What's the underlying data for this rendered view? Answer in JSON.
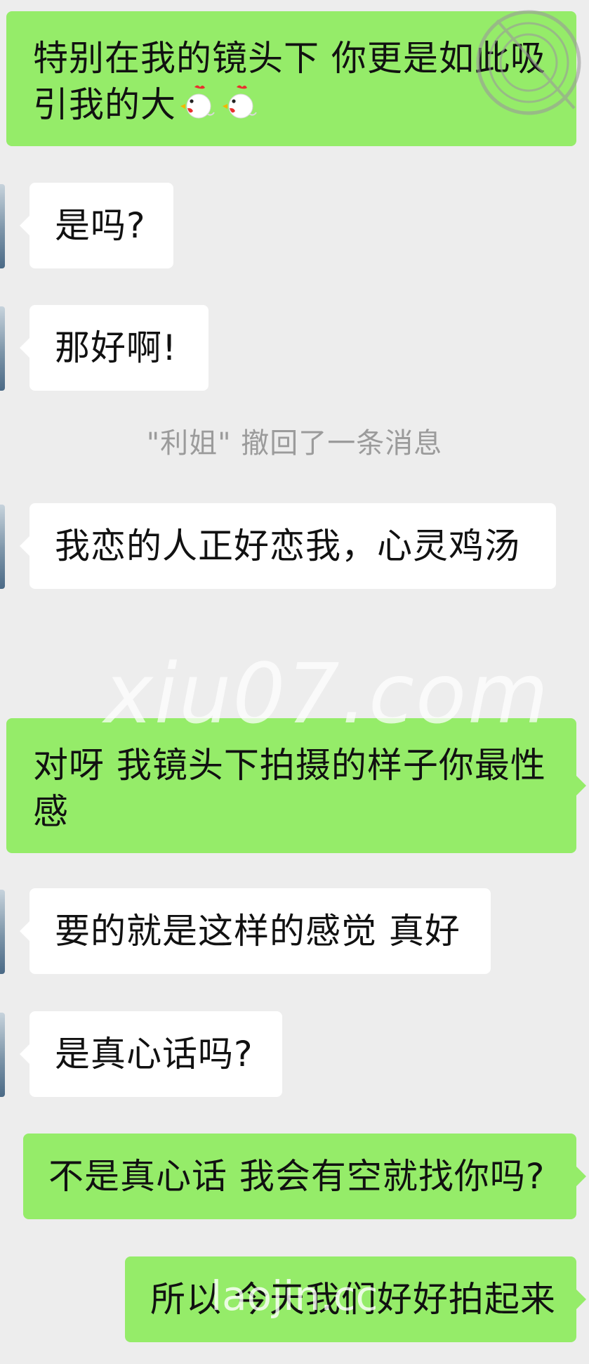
{
  "messages": [
    {
      "id": "m1",
      "side": "sent",
      "text": "特别在我的镜头下 你更是如此吸引我的大",
      "emoji": "rooster-emoji"
    },
    {
      "id": "m2",
      "side": "received",
      "text": "是吗?"
    },
    {
      "id": "m3",
      "side": "received",
      "text": "那好啊!"
    },
    {
      "id": "sys1",
      "side": "system",
      "text": "\"利姐\" 撤回了一条消息"
    },
    {
      "id": "m4",
      "side": "received",
      "text": "我恋的人正好恋我，心灵鸡汤"
    },
    {
      "id": "m5",
      "side": "sent",
      "text": "对呀 我镜头下拍摄的样子你最性感"
    },
    {
      "id": "m6",
      "side": "received",
      "text": "要的就是这样的感觉 真好"
    },
    {
      "id": "m7",
      "side": "received",
      "text": "是真心话吗?"
    },
    {
      "id": "m8",
      "side": "sent",
      "text": "不是真心话 我会有空就找你吗?"
    },
    {
      "id": "m9",
      "side": "sent",
      "text": "所以 今天我们好好拍起来"
    }
  ],
  "watermarks": {
    "center": "xiu07.com",
    "bottom": "laojin.cc"
  },
  "colors": {
    "background": "#ededed",
    "sent_bubble": "#95ec69",
    "received_bubble": "#ffffff",
    "system_text": "#9b9b9b"
  },
  "icons": {
    "emoji": "rooster-emoji",
    "stamp": "watermark-stamp-icon",
    "avatar": "contact-avatar"
  }
}
